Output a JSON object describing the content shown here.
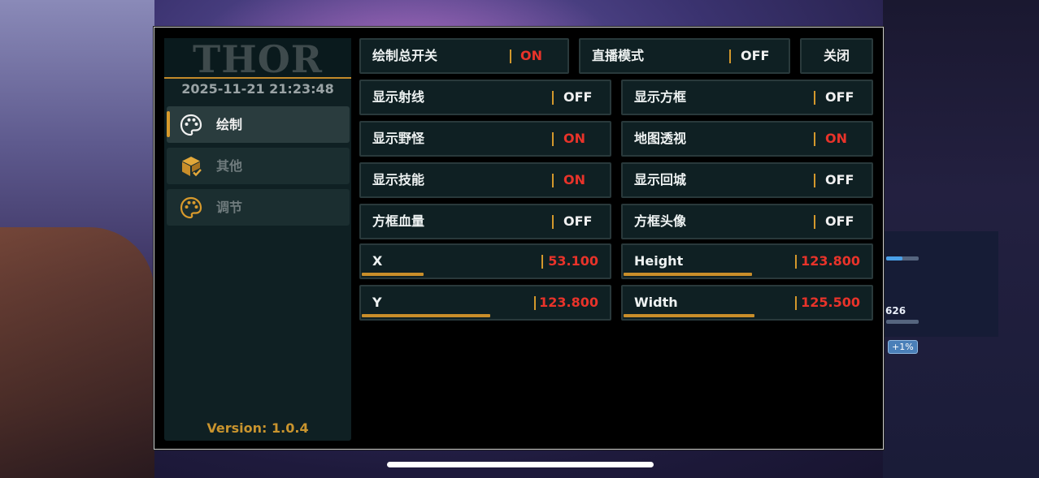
{
  "app": {
    "logo": "THOR",
    "datetime": "2025-11-21 21:23:48",
    "version": "Version: 1.0.4"
  },
  "sidebar": {
    "items": [
      {
        "label": "绘制",
        "icon": "palette-icon",
        "active": true
      },
      {
        "label": "其他",
        "icon": "cube-icon",
        "active": false
      },
      {
        "label": "调节",
        "icon": "palette-icon",
        "active": false
      }
    ]
  },
  "header": {
    "master": {
      "label": "绘制总开关",
      "value": "ON"
    },
    "stream": {
      "label": "直播模式",
      "value": "OFF"
    },
    "close_label": "关闭"
  },
  "toggles": [
    {
      "label": "显示射线",
      "value": "OFF"
    },
    {
      "label": "显示方框",
      "value": "OFF"
    },
    {
      "label": "显示野怪",
      "value": "ON"
    },
    {
      "label": "地图透视",
      "value": "ON"
    },
    {
      "label": "显示技能",
      "value": "ON"
    },
    {
      "label": "显示回城",
      "value": "OFF"
    },
    {
      "label": "方框血量",
      "value": "OFF"
    },
    {
      "label": "方框头像",
      "value": "OFF"
    }
  ],
  "sliders": [
    {
      "label": "X",
      "value": "53.100",
      "level": 0.25
    },
    {
      "label": "Height",
      "value": "123.800",
      "level": 0.52
    },
    {
      "label": "Y",
      "value": "123.800",
      "level": 0.52
    },
    {
      "label": "Width",
      "value": "125.500",
      "level": 0.53
    }
  ],
  "background": {
    "hud_value": "626",
    "hud_badge": "+1%"
  },
  "colors": {
    "accent": "#d89a2c",
    "on": "#e8332a",
    "off": "#f0f0f0",
    "panel": "#0f2023"
  }
}
